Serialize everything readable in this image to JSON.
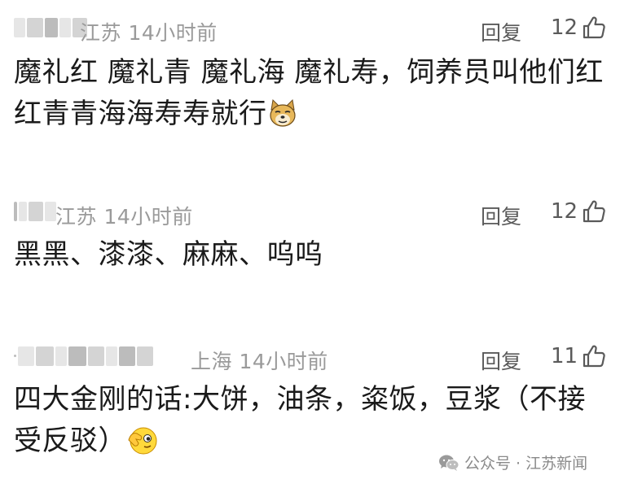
{
  "comments": [
    {
      "location": "江苏",
      "time": "14小时前",
      "reply_label": "回复",
      "likes": "12",
      "text": "魔礼红 魔礼青 魔礼海 魔礼寿，饲养员叫他们红红青青海海寿寿就行",
      "emoji": "doge-emoji"
    },
    {
      "location": "江苏",
      "time": "14小时前",
      "reply_label": "回复",
      "likes": "12",
      "text": "黑黑、漆漆、麻麻、呜呜"
    },
    {
      "location": "上海",
      "time": "14小时前",
      "reply_label": "回复",
      "likes": "11",
      "text": "四大金刚的话:大饼，油条，粢饭，豆浆（不接受反驳）",
      "emoji": "facepalm-emoji"
    }
  ],
  "watermark": {
    "icon": "wechat-icon",
    "text": "公众号 · 江苏新闻"
  },
  "colors": {
    "meta_text": "#9a9a9a",
    "action_text": "#5a5a5a",
    "body_text": "#1a1a1a"
  }
}
